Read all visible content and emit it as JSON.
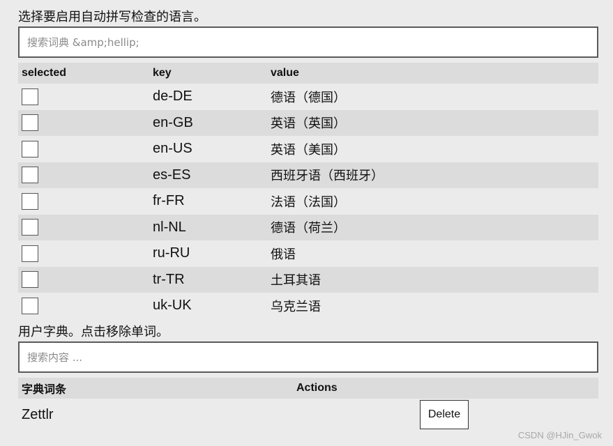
{
  "languages_section": {
    "label": "选择要启用自动拼写检查的语言。",
    "search_placeholder": "搜索词典 &amp;hellip;",
    "columns": {
      "selected": "selected",
      "key": "key",
      "value": "value"
    },
    "rows": [
      {
        "key": "de-DE",
        "value": "德语（德国）",
        "selected": false
      },
      {
        "key": "en-GB",
        "value": "英语（英国）",
        "selected": false
      },
      {
        "key": "en-US",
        "value": "英语（美国）",
        "selected": false
      },
      {
        "key": "es-ES",
        "value": "西班牙语（西班牙）",
        "selected": false
      },
      {
        "key": "fr-FR",
        "value": "法语（法国）",
        "selected": false
      },
      {
        "key": "nl-NL",
        "value": "德语（荷兰）",
        "selected": false
      },
      {
        "key": "ru-RU",
        "value": "俄语",
        "selected": false
      },
      {
        "key": "tr-TR",
        "value": "土耳其语",
        "selected": false
      },
      {
        "key": "uk-UK",
        "value": "乌克兰语",
        "selected": false
      }
    ]
  },
  "dictionary_section": {
    "label": "用户字典。点击移除单词。",
    "search_placeholder": "搜索内容 ...",
    "columns": {
      "word": "字典词条",
      "actions": "Actions"
    },
    "rows": [
      {
        "word": "Zettlr",
        "action_label": "Delete"
      }
    ]
  },
  "watermark": "CSDN @HJin_Gwok"
}
